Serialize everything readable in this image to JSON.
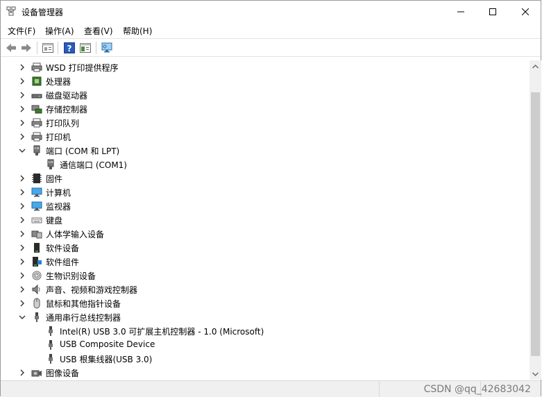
{
  "window": {
    "title": "设备管理器",
    "minimize_label": "—",
    "maximize_label": "☐",
    "close_label": "✕"
  },
  "menu": [
    "文件(F)",
    "操作(A)",
    "查看(V)",
    "帮助(H)"
  ],
  "toolbar": {
    "buttons": [
      "back-icon",
      "forward-icon",
      "properties-view-icon",
      "help-icon",
      "console-tree-icon",
      "scan-hardware-icon"
    ]
  },
  "tree": [
    {
      "label": "WSD 打印提供程序",
      "icon": "printer-icon",
      "expanded": false,
      "level": 0
    },
    {
      "label": "处理器",
      "icon": "processor-icon",
      "expanded": false,
      "level": 0
    },
    {
      "label": "磁盘驱动器",
      "icon": "disk-drive-icon",
      "expanded": false,
      "level": 0
    },
    {
      "label": "存储控制器",
      "icon": "storage-controller-icon",
      "expanded": false,
      "level": 0
    },
    {
      "label": "打印队列",
      "icon": "print-queue-icon",
      "expanded": false,
      "level": 0
    },
    {
      "label": "打印机",
      "icon": "printer-icon",
      "expanded": false,
      "level": 0
    },
    {
      "label": "端口 (COM 和 LPT)",
      "icon": "port-icon",
      "expanded": true,
      "level": 0
    },
    {
      "label": "通信端口 (COM1)",
      "icon": "port-icon",
      "expanded": null,
      "level": 1
    },
    {
      "label": "固件",
      "icon": "firmware-icon",
      "expanded": false,
      "level": 0
    },
    {
      "label": "计算机",
      "icon": "computer-icon",
      "expanded": false,
      "level": 0
    },
    {
      "label": "监视器",
      "icon": "monitor-icon",
      "expanded": false,
      "level": 0
    },
    {
      "label": "键盘",
      "icon": "keyboard-icon",
      "expanded": false,
      "level": 0
    },
    {
      "label": "人体学输入设备",
      "icon": "hid-icon",
      "expanded": false,
      "level": 0
    },
    {
      "label": "软件设备",
      "icon": "software-device-icon",
      "expanded": false,
      "level": 0
    },
    {
      "label": "软件组件",
      "icon": "software-component-icon",
      "expanded": false,
      "level": 0
    },
    {
      "label": "生物识别设备",
      "icon": "fingerprint-icon",
      "expanded": false,
      "level": 0
    },
    {
      "label": "声音、视频和游戏控制器",
      "icon": "speaker-icon",
      "expanded": false,
      "level": 0
    },
    {
      "label": "鼠标和其他指针设备",
      "icon": "mouse-icon",
      "expanded": false,
      "level": 0
    },
    {
      "label": "通用串行总线控制器",
      "icon": "usb-icon",
      "expanded": true,
      "level": 0
    },
    {
      "label": "Intel(R) USB 3.0 可扩展主机控制器 - 1.0 (Microsoft)",
      "icon": "usb-icon",
      "expanded": null,
      "level": 1
    },
    {
      "label": "USB Composite Device",
      "icon": "usb-icon",
      "expanded": null,
      "level": 1
    },
    {
      "label": "USB 根集线器(USB 3.0)",
      "icon": "usb-icon",
      "expanded": null,
      "level": 1
    },
    {
      "label": "图像设备",
      "icon": "camera-icon",
      "expanded": false,
      "level": 0
    }
  ],
  "watermark": "CSDN @qq_42683042"
}
